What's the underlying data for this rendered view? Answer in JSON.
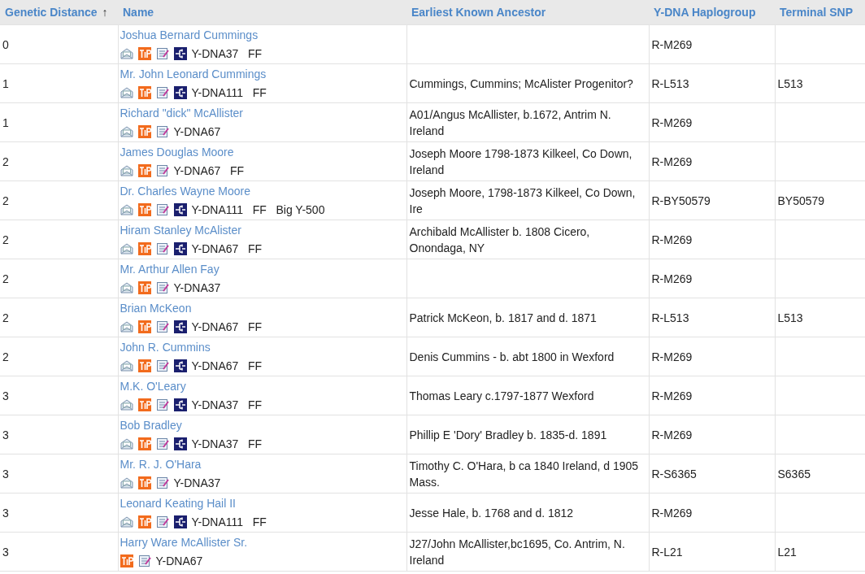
{
  "table": {
    "columns": [
      {
        "label": "Genetic Distance",
        "sort_indicator": "↑"
      },
      {
        "label": "Name"
      },
      {
        "label": "Earliest Known Ancestor"
      },
      {
        "label": "Y-DNA Haplogroup"
      },
      {
        "label": "Terminal SNP"
      }
    ],
    "rows": [
      {
        "distance": "0",
        "name": "Joshua Bernard Cummings",
        "email": true,
        "tip": true,
        "notes": true,
        "tree": true,
        "tests": "Y-DNA37   FF",
        "ancestor": "",
        "haplogroup": "R-M269",
        "snp": ""
      },
      {
        "distance": "1",
        "name": "Mr. John Leonard Cummings",
        "email": true,
        "tip": true,
        "notes": true,
        "tree": true,
        "tests": "Y-DNA111   FF",
        "ancestor": "Cummings, Cummins; McAlister Progenitor?",
        "haplogroup": "R-L513",
        "snp": "L513"
      },
      {
        "distance": "1",
        "name": "Richard \"dick\" McAllister",
        "email": true,
        "tip": true,
        "notes": true,
        "tree": false,
        "tests": "Y-DNA67",
        "ancestor": "A01/Angus McAllister, b.1672, Antrim N. Ireland",
        "haplogroup": "R-M269",
        "snp": ""
      },
      {
        "distance": "2",
        "name": "James Douglas Moore",
        "email": true,
        "tip": true,
        "notes": true,
        "tree": false,
        "tests": "Y-DNA67   FF",
        "ancestor": "Joseph Moore 1798-1873 Kilkeel, Co Down, Ireland",
        "haplogroup": "R-M269",
        "snp": ""
      },
      {
        "distance": "2",
        "name": "Dr. Charles Wayne Moore",
        "email": true,
        "tip": true,
        "notes": true,
        "tree": true,
        "tests": "Y-DNA111   FF   Big Y-500",
        "ancestor": "Joseph Moore, 1798-1873 Kilkeel, Co Down, Ire",
        "haplogroup": "R-BY50579",
        "snp": "BY50579"
      },
      {
        "distance": "2",
        "name": "Hiram Stanley McAlister",
        "email": true,
        "tip": true,
        "notes": true,
        "tree": true,
        "tests": "Y-DNA67   FF",
        "ancestor": "Archibald McAllister b. 1808 Cicero, Onondaga, NY",
        "haplogroup": "R-M269",
        "snp": ""
      },
      {
        "distance": "2",
        "name": "Mr. Arthur Allen Fay",
        "email": true,
        "tip": true,
        "notes": true,
        "tree": false,
        "tests": "Y-DNA37",
        "ancestor": "",
        "haplogroup": "R-M269",
        "snp": ""
      },
      {
        "distance": "2",
        "name": "Brian McKeon",
        "email": true,
        "tip": true,
        "notes": true,
        "tree": true,
        "tests": "Y-DNA67   FF",
        "ancestor": "Patrick McKeon, b. 1817 and d. 1871",
        "haplogroup": "R-L513",
        "snp": "L513"
      },
      {
        "distance": "2",
        "name": "John R. Cummins",
        "email": true,
        "tip": true,
        "notes": true,
        "tree": true,
        "tests": "Y-DNA67   FF",
        "ancestor": "Denis Cummins - b. abt 1800 in Wexford",
        "haplogroup": "R-M269",
        "snp": ""
      },
      {
        "distance": "3",
        "name": "M.K. O'Leary",
        "email": true,
        "tip": true,
        "notes": true,
        "tree": true,
        "tests": "Y-DNA37   FF",
        "ancestor": "Thomas Leary c.1797-1877 Wexford",
        "haplogroup": "R-M269",
        "snp": ""
      },
      {
        "distance": "3",
        "name": "Bob Bradley",
        "email": true,
        "tip": true,
        "notes": true,
        "tree": true,
        "tests": "Y-DNA37   FF",
        "ancestor": "Phillip E 'Dory' Bradley b. 1835-d. 1891",
        "haplogroup": "R-M269",
        "snp": ""
      },
      {
        "distance": "3",
        "name": "Mr. R. J. O'Hara",
        "email": true,
        "tip": true,
        "notes": true,
        "tree": false,
        "tests": "Y-DNA37",
        "ancestor": "Timothy C. O'Hara, b ca 1840 Ireland, d 1905 Mass.",
        "haplogroup": "R-S6365",
        "snp": "S6365"
      },
      {
        "distance": "3",
        "name": "Leonard Keating Hail II",
        "email": true,
        "tip": true,
        "notes": true,
        "tree": true,
        "tests": "Y-DNA111   FF",
        "ancestor": "Jesse Hale, b. 1768 and d. 1812",
        "haplogroup": "R-M269",
        "snp": ""
      },
      {
        "distance": "3",
        "name": "Harry Ware McAllister Sr.",
        "email": false,
        "tip": true,
        "notes": true,
        "tree": false,
        "tests": "Y-DNA67",
        "ancestor": "J27/John McAllister,bc1695, Co. Antrim, N. Ireland",
        "haplogroup": "R-L21",
        "snp": "L21"
      }
    ]
  }
}
